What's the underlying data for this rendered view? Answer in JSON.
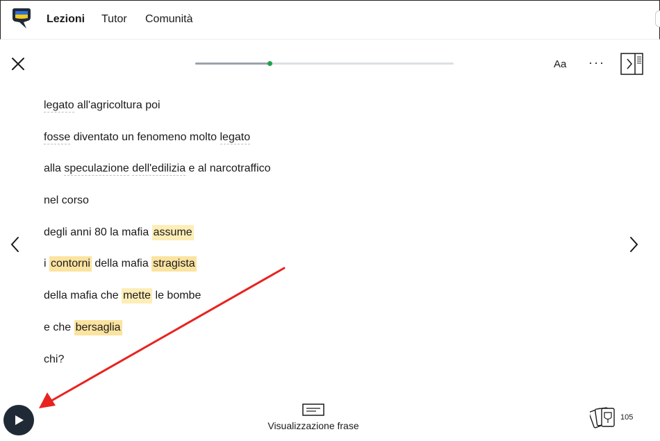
{
  "nav": {
    "items": [
      {
        "label": "Lezioni",
        "active": true
      },
      {
        "label": "Tutor",
        "active": false
      },
      {
        "label": "Comunità",
        "active": false
      }
    ]
  },
  "toolbar": {
    "font_label": "Aa",
    "more_label": "···",
    "progress_fraction": 0.29
  },
  "transcript": {
    "lines": [
      [
        {
          "t": "legato",
          "s": "ul"
        },
        {
          "t": " all'agricoltura poi",
          "s": ""
        }
      ],
      [
        {
          "t": "fosse",
          "s": "ul"
        },
        {
          "t": " diventato un fenomeno molto ",
          "s": ""
        },
        {
          "t": "legato",
          "s": "ul"
        }
      ],
      [
        {
          "t": "alla ",
          "s": ""
        },
        {
          "t": "speculazione",
          "s": "ul"
        },
        {
          "t": " ",
          "s": ""
        },
        {
          "t": "dell'edilizia",
          "s": "ul"
        },
        {
          "t": " e al narcotraffico",
          "s": ""
        }
      ],
      [
        {
          "t": "nel corso",
          "s": ""
        }
      ],
      [
        {
          "t": "degli anni 80 la mafia ",
          "s": ""
        },
        {
          "t": "assume",
          "s": "hl"
        }
      ],
      [
        {
          "t": "i ",
          "s": ""
        },
        {
          "t": "contorni",
          "s": "hl2"
        },
        {
          "t": " della mafia ",
          "s": ""
        },
        {
          "t": "stragista",
          "s": "hl2"
        }
      ],
      [
        {
          "t": "della mafia che ",
          "s": ""
        },
        {
          "t": "mette",
          "s": "hl"
        },
        {
          "t": " le bombe",
          "s": ""
        }
      ],
      [
        {
          "t": "e che ",
          "s": ""
        },
        {
          "t": "bersaglia",
          "s": "hl2"
        }
      ],
      [
        {
          "t": "chi?",
          "s": ""
        }
      ]
    ]
  },
  "footer": {
    "view_label": "Visualizzazione frase",
    "cards_count": "105"
  },
  "colors": {
    "highlight": "#fdeeb7",
    "highlight_strong": "#fbe3a0",
    "progress_dot": "#1fa34a",
    "play_button": "#1f2a36",
    "annotation_arrow": "#e8231f"
  }
}
